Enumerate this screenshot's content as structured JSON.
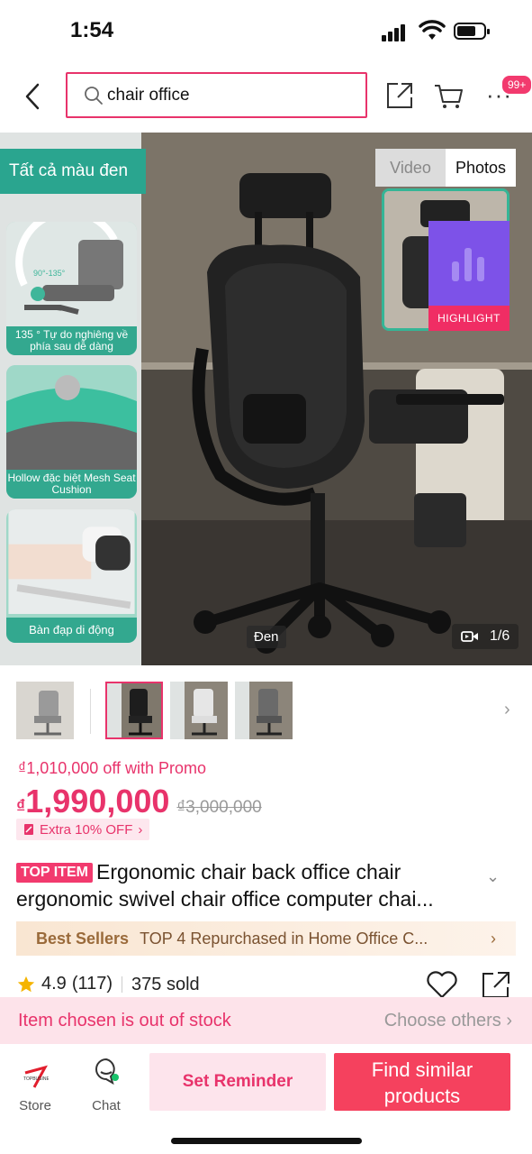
{
  "status_bar": {
    "time": "1:54"
  },
  "header": {
    "search_query": "chair office",
    "cart_badge": "99+"
  },
  "hero": {
    "color_banner": "Tất cả màu đen",
    "features": [
      {
        "caption": "135 ° Tự do nghiêng về phía sau dễ dàng"
      },
      {
        "caption": "Hollow đặc biệt Mesh Seat Cushion"
      },
      {
        "caption": "Bàn đạp di động"
      }
    ],
    "media_tabs": {
      "video": "Video",
      "photos": "Photos"
    },
    "highlight_label": "HIGHLIGHT",
    "variant_label": "Đen",
    "image_counter": "1/6"
  },
  "pricing": {
    "promo_text": "₫1,010,000 off with Promo",
    "currency": "₫",
    "price": "1,990,000",
    "original_price": "₫3,000,000",
    "extra_discount": "Extra 10% OFF"
  },
  "product": {
    "tag": "TOP ITEM",
    "title": "Ergonomic chair back office chair ergonomic swivel chair office computer chai..."
  },
  "best_sellers": {
    "label": "Best Sellers",
    "text": "TOP 4 Repurchased in Home Office C..."
  },
  "rating": {
    "score": "4.9",
    "count": "(117)",
    "sold": "375 sold"
  },
  "stock_notice": {
    "message": "Item chosen is out of stock",
    "action": "Choose others"
  },
  "bottom_bar": {
    "store_label": "Store",
    "chat_label": "Chat",
    "reminder_label": "Set Reminder",
    "similar_label": "Find similar products"
  },
  "colors": {
    "accent": "#e8336b",
    "teal": "#2aa58f",
    "highlight": "#7d52e8",
    "primary_button": "#f5415e"
  }
}
